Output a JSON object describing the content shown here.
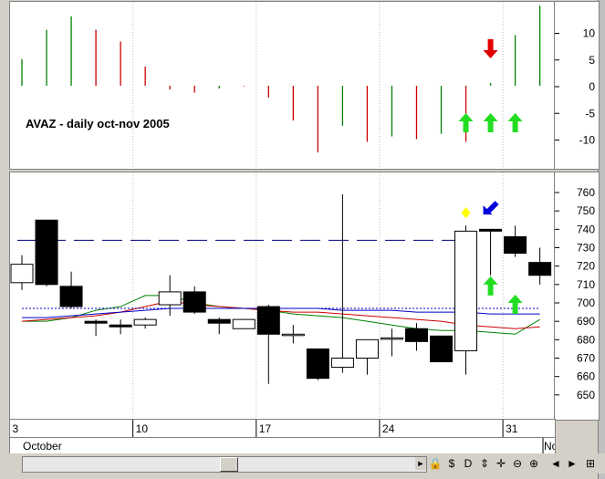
{
  "chart_title": "AVAZ - daily  oct-nov 2005",
  "month_labels": [
    "October",
    "No"
  ],
  "chart_data": [
    {
      "type": "bar",
      "name": "oscillator",
      "ylim": [
        -13,
        15
      ],
      "yticks": [
        10,
        5,
        0,
        -5,
        -10
      ],
      "x": [
        "2005-10-03",
        "2005-10-04",
        "2005-10-05",
        "2005-10-06",
        "2005-10-07",
        "2005-10-10",
        "2005-10-11",
        "2005-10-12",
        "2005-10-13",
        "2005-10-14",
        "2005-10-17",
        "2005-10-18",
        "2005-10-19",
        "2005-10-20",
        "2005-10-21",
        "2005-10-24",
        "2005-10-25",
        "2005-10-26",
        "2005-10-27",
        "2005-10-28",
        "2005-10-31",
        "2005-11-01"
      ],
      "values": [
        5,
        10.5,
        13,
        10.5,
        8.3,
        3.6,
        -0.7,
        -1.3,
        -0.5,
        -0.1,
        -2.2,
        -6.5,
        -12.5,
        -7.5,
        -10.5,
        -9.5,
        -10,
        -9,
        -10.5,
        0.5,
        9.5,
        15
      ],
      "colors": [
        "#008000",
        "#008000",
        "#008000",
        "#cc0000",
        "#cc0000",
        "#cc0000",
        "#cc0000",
        "#cc0000",
        "#008000",
        "#cc0000",
        "#cc0000",
        "#cc0000",
        "#cc0000",
        "#008000",
        "#cc0000",
        "#008000",
        "#cc0000",
        "#008000",
        "#cc0000",
        "#008000",
        "#008000",
        "#008000"
      ]
    },
    {
      "type": "candlestick",
      "name": "price",
      "ylim": [
        645,
        766
      ],
      "yticks": [
        760,
        750,
        740,
        730,
        720,
        710,
        700,
        690,
        680,
        670,
        660,
        650
      ],
      "xtick_labels": [
        "3",
        "10",
        "17",
        "24",
        "31"
      ],
      "reference_level": 734,
      "candles": [
        {
          "date": "2005-10-03",
          "open": 711,
          "high": 726,
          "low": 707,
          "close": 721
        },
        {
          "date": "2005-10-04",
          "open": 745,
          "high": 745,
          "low": 709,
          "close": 710
        },
        {
          "date": "2005-10-05",
          "open": 709,
          "high": 717,
          "low": 697,
          "close": 698
        },
        {
          "date": "2005-10-06",
          "open": 690,
          "high": 691,
          "low": 682,
          "close": 689
        },
        {
          "date": "2005-10-07",
          "open": 688,
          "high": 691,
          "low": 683,
          "close": 687
        },
        {
          "date": "2005-10-10",
          "open": 688,
          "high": 692,
          "low": 686,
          "close": 691
        },
        {
          "date": "2005-10-11",
          "open": 699,
          "high": 715,
          "low": 693,
          "close": 706
        },
        {
          "date": "2005-10-12",
          "open": 706,
          "high": 709,
          "low": 694,
          "close": 695
        },
        {
          "date": "2005-10-13",
          "open": 691,
          "high": 692,
          "low": 683,
          "close": 689
        },
        {
          "date": "2005-10-14",
          "open": 686,
          "high": 691,
          "low": 686,
          "close": 691
        },
        {
          "date": "2005-10-17",
          "open": 698,
          "high": 699,
          "low": 656,
          "close": 683
        },
        {
          "date": "2005-10-18",
          "open": 683,
          "high": 688,
          "low": 678,
          "close": 683
        },
        {
          "date": "2005-10-19",
          "open": 675,
          "high": 675,
          "low": 658,
          "close": 659
        },
        {
          "date": "2005-10-20",
          "open": 665,
          "high": 759,
          "low": 662,
          "close": 670
        },
        {
          "date": "2005-10-21",
          "open": 670,
          "high": 680,
          "low": 661,
          "close": 680
        },
        {
          "date": "2005-10-24",
          "open": 681,
          "high": 686,
          "low": 671,
          "close": 681
        },
        {
          "date": "2005-10-25",
          "open": 686,
          "high": 689,
          "low": 674,
          "close": 679
        },
        {
          "date": "2005-10-26",
          "open": 682,
          "high": 682,
          "low": 668,
          "close": 668
        },
        {
          "date": "2005-10-27",
          "open": 674,
          "high": 742,
          "low": 661,
          "close": 739
        },
        {
          "date": "2005-10-28",
          "open": 740,
          "high": 740,
          "low": 715,
          "close": 739
        },
        {
          "date": "2005-10-31",
          "open": 736,
          "high": 742,
          "low": 725,
          "close": 727
        },
        {
          "date": "2005-11-01",
          "open": 722,
          "high": 730,
          "low": 710,
          "close": 715
        }
      ],
      "series": [
        {
          "color": "#008000",
          "values": [
            690,
            690,
            692,
            696,
            698,
            704,
            704,
            700,
            698,
            697,
            696,
            694,
            693,
            692,
            690,
            688,
            686,
            685,
            685,
            684,
            683,
            691
          ]
        },
        {
          "color": "#cc0000",
          "values": [
            690,
            691,
            692,
            693,
            695,
            698,
            701,
            699,
            698,
            697,
            696,
            695,
            695,
            694,
            693,
            692,
            691,
            690,
            688,
            687,
            686,
            687
          ]
        },
        {
          "color": "#0000cc",
          "values": [
            692,
            692,
            693,
            694,
            695,
            696,
            697,
            697,
            697,
            697,
            697,
            697,
            697,
            696,
            696,
            696,
            695,
            695,
            695,
            694,
            694,
            694
          ]
        },
        {
          "color": "#0000cc",
          "style": "dotted",
          "values": [
            697,
            697,
            697,
            697,
            697,
            697,
            697,
            697,
            697,
            697,
            697,
            697,
            697,
            697,
            697,
            697,
            697,
            697,
            697,
            697,
            697,
            697
          ]
        }
      ]
    }
  ],
  "markers": [
    {
      "pane": "oscillator",
      "type": "arrow-down",
      "color": "#e00000",
      "date": "2005-10-28",
      "value": 7
    },
    {
      "pane": "oscillator",
      "type": "arrow-up",
      "color": "#22dd22",
      "date": "2005-10-27",
      "value": -7
    },
    {
      "pane": "oscillator",
      "type": "arrow-up",
      "color": "#22dd22",
      "date": "2005-10-28",
      "value": -7
    },
    {
      "pane": "oscillator",
      "type": "arrow-up",
      "color": "#22dd22",
      "date": "2005-10-31",
      "value": -7
    },
    {
      "pane": "price",
      "type": "diamond",
      "color": "#ffff00",
      "date": "2005-10-27",
      "value": 749
    },
    {
      "pane": "price",
      "type": "arrow-down-left",
      "color": "#0000dd",
      "date": "2005-10-28",
      "value": 752
    },
    {
      "pane": "price",
      "type": "arrow-up",
      "color": "#22dd22",
      "date": "2005-10-28",
      "value": 709
    },
    {
      "pane": "price",
      "type": "arrow-up",
      "color": "#22dd22",
      "date": "2005-10-31",
      "value": 699
    }
  ],
  "toolbar": {
    "icons": [
      "scroll-left-arrow",
      "scroll-right-arrow",
      "lock-icon",
      "dollar-icon",
      "d-icon",
      "vertical-resize-icon",
      "move-icon",
      "zoom-out-icon",
      "zoom-in-icon",
      "left-arrow-icon",
      "right-arrow-icon",
      "maximize-icon"
    ],
    "buttons": [
      "◄",
      "►",
      "🔒",
      "$",
      "D",
      "⇕",
      "✛",
      "⊖",
      "⊕",
      "◄",
      "►",
      "⊞"
    ]
  }
}
